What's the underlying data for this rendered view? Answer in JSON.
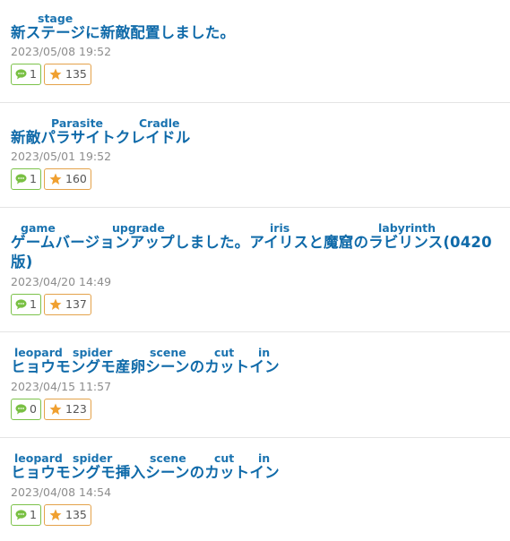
{
  "posts": [
    {
      "title": "新ステージに新敵配置しました。",
      "title_line2": "",
      "ruby": [
        {
          "text": "stage"
        }
      ],
      "date": "2023/05/08 19:52",
      "comments": "1",
      "favorites": "135"
    },
    {
      "title": "新敵パラサイトクレイドル",
      "title_line2": "",
      "ruby": [
        {
          "text": "Parasite"
        },
        {
          "text": "Cradle"
        }
      ],
      "date": "2023/05/01 19:52",
      "comments": "1",
      "favorites": "160"
    },
    {
      "title": "ゲームバージョンアップしました。アイリスと魔窟のラビリンス(0420",
      "title_line2": "版)",
      "ruby": [
        {
          "text": "game"
        },
        {
          "text": "upgrade"
        },
        {
          "text": "iris"
        },
        {
          "text": "labyrinth"
        }
      ],
      "date": "2023/04/20 14:49",
      "comments": "1",
      "favorites": "137"
    },
    {
      "title": "ヒョウモングモ産卵シーンのカットイン",
      "title_line2": "",
      "ruby": [
        {
          "text": "leopard"
        },
        {
          "text": "spider"
        },
        {
          "text": "scene"
        },
        {
          "text": "cut"
        },
        {
          "text": "in"
        }
      ],
      "date": "2023/04/15 11:57",
      "comments": "0",
      "favorites": "123"
    },
    {
      "title": "ヒョウモングモ挿入シーンのカットイン",
      "title_line2": "",
      "ruby": [
        {
          "text": "leopard"
        },
        {
          "text": "spider"
        },
        {
          "text": "scene"
        },
        {
          "text": "cut"
        },
        {
          "text": "in"
        }
      ],
      "date": "2023/04/08 14:54",
      "comments": "1",
      "favorites": "135"
    }
  ],
  "icons": {
    "comment": "speech-bubble-icon",
    "favorite": "star-icon"
  },
  "colors": {
    "title": "#0f6aa9",
    "comment_border": "#7cc24a",
    "favorite_border": "#e4a24a",
    "star": "#f0a030",
    "bubble": "#79c043"
  }
}
